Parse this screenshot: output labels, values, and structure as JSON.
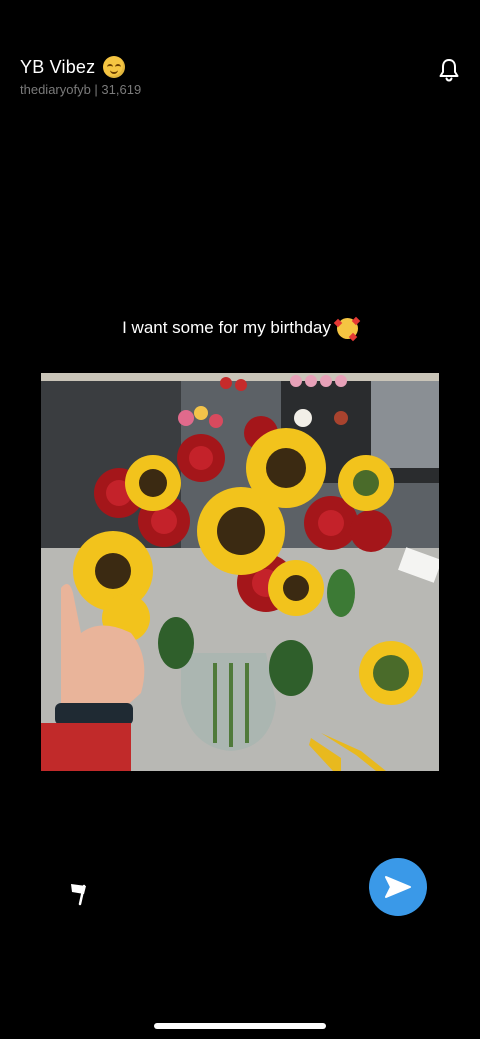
{
  "header": {
    "title": "YB Vibez",
    "title_emoji": "relieved-face-emoji",
    "subtitle": "thediaryofyb | 31,619",
    "bell_icon": "bell-icon"
  },
  "post": {
    "caption": "I want some for my birthday",
    "caption_emoji": "smiling-face-with-hearts-emoji",
    "image_subject": "bouquet-of-red-roses-and-sunflowers"
  },
  "actions": {
    "flag_icon": "flag-icon",
    "send_icon": "send-icon",
    "send_color": "#3a99e8"
  }
}
